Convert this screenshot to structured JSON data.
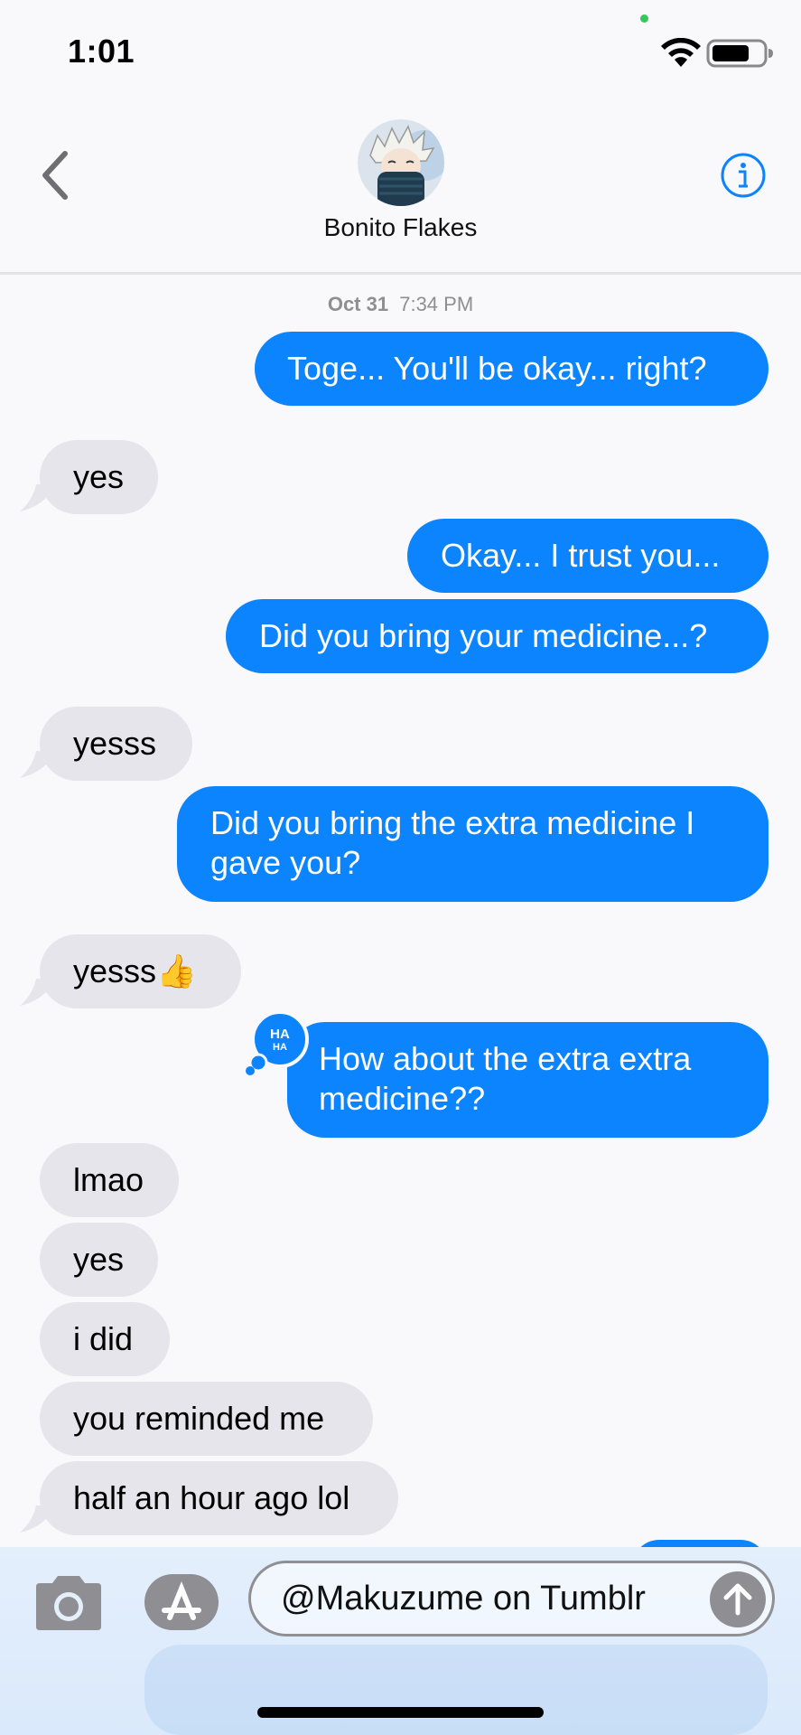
{
  "status_bar": {
    "time": "1:01",
    "icons": [
      "wifi-icon",
      "battery-icon"
    ]
  },
  "header": {
    "contact_name": "Bonito Flakes",
    "icons": [
      "chevron-left-icon",
      "info-icon",
      "avatar"
    ]
  },
  "conversation": {
    "timestamp_date": "Oct 31",
    "timestamp_time": "7:34 PM",
    "messages": [
      {
        "direction": "out",
        "text": "Toge... You'll be okay... right?"
      },
      {
        "direction": "in",
        "text": "yes"
      },
      {
        "direction": "out",
        "text": "Okay... I trust you..."
      },
      {
        "direction": "out",
        "text": "Did you bring your medicine...?"
      },
      {
        "direction": "in",
        "text": "yesss"
      },
      {
        "direction": "out",
        "text": "Did you bring the extra medicine I gave you?"
      },
      {
        "direction": "in",
        "text": "yesss👍"
      },
      {
        "direction": "out",
        "text": "How about the extra extra medicine??",
        "tapback": "HA HA"
      },
      {
        "direction": "in",
        "text": "lmao"
      },
      {
        "direction": "in",
        "text": "yes"
      },
      {
        "direction": "in",
        "text": "i did"
      },
      {
        "direction": "in",
        "text": "you reminded me"
      },
      {
        "direction": "in",
        "text": "half an hour ago lol"
      }
    ]
  },
  "composer": {
    "input_value": "@Makuzume on Tumblr",
    "icons": [
      "camera-icon",
      "app-store-icon",
      "send-arrow-icon"
    ]
  },
  "colors": {
    "outgoing_bubble": "#0b84fe",
    "incoming_bubble": "#e6e5eb",
    "background": "#f9f9fb",
    "accent": "#0b84fe"
  }
}
